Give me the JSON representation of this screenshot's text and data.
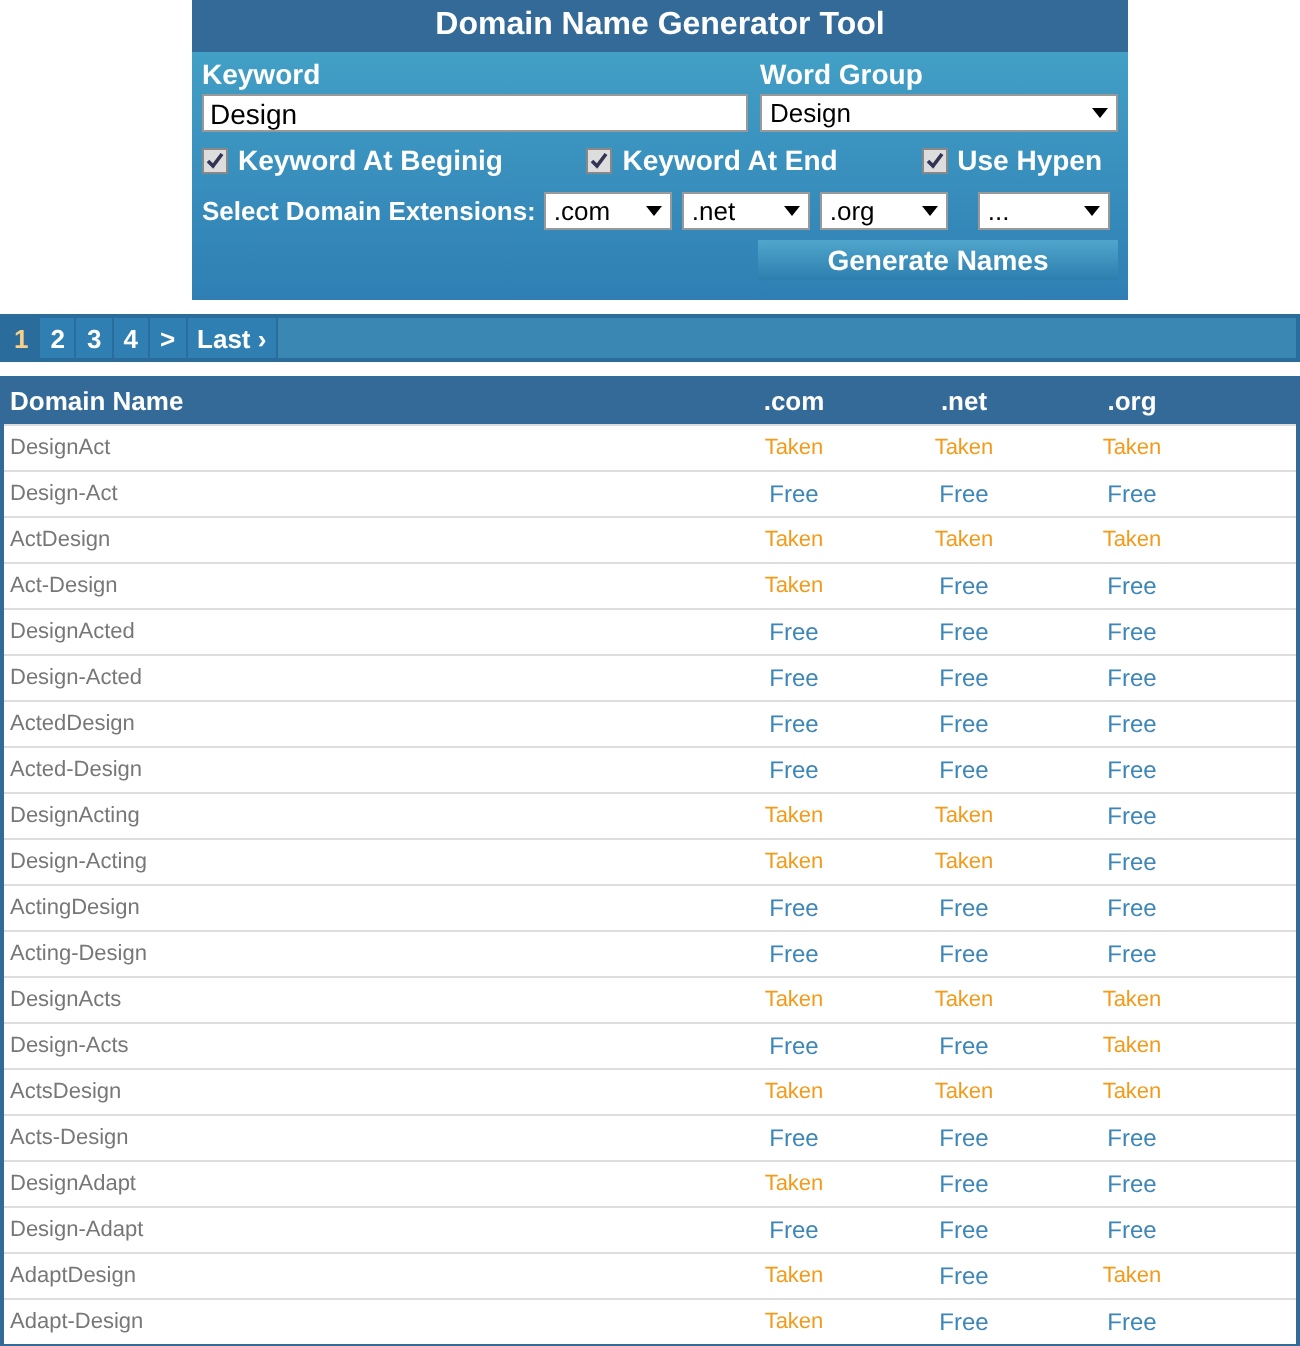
{
  "form": {
    "title": "Domain Name Generator Tool",
    "keyword_label": "Keyword",
    "keyword_value": "Design",
    "group_label": "Word Group",
    "group_value": "Design",
    "options": [
      {
        "label": "Keyword At Beginig",
        "checked": true
      },
      {
        "label": "Keyword At End",
        "checked": true
      },
      {
        "label": "Use Hypen",
        "checked": true
      }
    ],
    "extensions_label": "Select Domain Extensions:",
    "extensions": [
      ".com",
      ".net",
      ".org",
      "..."
    ],
    "button": "Generate Names"
  },
  "pagination": [
    {
      "label": "1",
      "selected": true
    },
    {
      "label": "2",
      "selected": false
    },
    {
      "label": "3",
      "selected": false
    },
    {
      "label": "4",
      "selected": false
    },
    {
      "label": ">",
      "selected": false
    },
    {
      "label": "Last ›",
      "selected": false
    }
  ],
  "table": {
    "columns": [
      "Domain Name",
      ".com",
      ".net",
      ".org"
    ],
    "rows": [
      {
        "cells": [
          {
            "kind": "name",
            "text": "DesignAct"
          },
          {
            "kind": "status",
            "text": "Taken",
            "taken": true
          },
          {
            "kind": "status",
            "text": "Taken",
            "taken": true
          },
          {
            "kind": "status",
            "text": "Taken",
            "taken": true
          }
        ]
      },
      {
        "cells": [
          {
            "kind": "name",
            "text": "Design-Act"
          },
          {
            "kind": "status",
            "text": "Free",
            "taken": false
          },
          {
            "kind": "status",
            "text": "Free",
            "taken": false
          },
          {
            "kind": "status",
            "text": "Free",
            "taken": false
          }
        ]
      },
      {
        "cells": [
          {
            "kind": "name",
            "text": "ActDesign"
          },
          {
            "kind": "status",
            "text": "Taken",
            "taken": true
          },
          {
            "kind": "status",
            "text": "Taken",
            "taken": true
          },
          {
            "kind": "status",
            "text": "Taken",
            "taken": true
          }
        ]
      },
      {
        "cells": [
          {
            "kind": "name",
            "text": "Act-Design"
          },
          {
            "kind": "status",
            "text": "Taken",
            "taken": true
          },
          {
            "kind": "status",
            "text": "Free",
            "taken": false
          },
          {
            "kind": "status",
            "text": "Free",
            "taken": false
          }
        ]
      },
      {
        "cells": [
          {
            "kind": "name",
            "text": "DesignActed"
          },
          {
            "kind": "status",
            "text": "Free",
            "taken": false
          },
          {
            "kind": "status",
            "text": "Free",
            "taken": false
          },
          {
            "kind": "status",
            "text": "Free",
            "taken": false
          }
        ]
      },
      {
        "cells": [
          {
            "kind": "name",
            "text": "Design-Acted"
          },
          {
            "kind": "status",
            "text": "Free",
            "taken": false
          },
          {
            "kind": "status",
            "text": "Free",
            "taken": false
          },
          {
            "kind": "status",
            "text": "Free",
            "taken": false
          }
        ]
      },
      {
        "cells": [
          {
            "kind": "name",
            "text": "ActedDesign"
          },
          {
            "kind": "status",
            "text": "Free",
            "taken": false
          },
          {
            "kind": "status",
            "text": "Free",
            "taken": false
          },
          {
            "kind": "status",
            "text": "Free",
            "taken": false
          }
        ]
      },
      {
        "cells": [
          {
            "kind": "name",
            "text": "Acted-Design"
          },
          {
            "kind": "status",
            "text": "Free",
            "taken": false
          },
          {
            "kind": "status",
            "text": "Free",
            "taken": false
          },
          {
            "kind": "status",
            "text": "Free",
            "taken": false
          }
        ]
      },
      {
        "cells": [
          {
            "kind": "name",
            "text": "DesignActing"
          },
          {
            "kind": "status",
            "text": "Taken",
            "taken": true
          },
          {
            "kind": "status",
            "text": "Taken",
            "taken": true
          },
          {
            "kind": "status",
            "text": "Free",
            "taken": false
          }
        ]
      },
      {
        "cells": [
          {
            "kind": "name",
            "text": "Design-Acting"
          },
          {
            "kind": "status",
            "text": "Taken",
            "taken": true
          },
          {
            "kind": "status",
            "text": "Taken",
            "taken": true
          },
          {
            "kind": "status",
            "text": "Free",
            "taken": false
          }
        ]
      },
      {
        "cells": [
          {
            "kind": "name",
            "text": "ActingDesign"
          },
          {
            "kind": "status",
            "text": "Free",
            "taken": false
          },
          {
            "kind": "status",
            "text": "Free",
            "taken": false
          },
          {
            "kind": "status",
            "text": "Free",
            "taken": false
          }
        ]
      },
      {
        "cells": [
          {
            "kind": "name",
            "text": "Acting-Design"
          },
          {
            "kind": "status",
            "text": "Free",
            "taken": false
          },
          {
            "kind": "status",
            "text": "Free",
            "taken": false
          },
          {
            "kind": "status",
            "text": "Free",
            "taken": false
          }
        ]
      },
      {
        "cells": [
          {
            "kind": "name",
            "text": "DesignActs"
          },
          {
            "kind": "status",
            "text": "Taken",
            "taken": true
          },
          {
            "kind": "status",
            "text": "Taken",
            "taken": true
          },
          {
            "kind": "status",
            "text": "Taken",
            "taken": true
          }
        ]
      },
      {
        "cells": [
          {
            "kind": "name",
            "text": "Design-Acts"
          },
          {
            "kind": "status",
            "text": "Free",
            "taken": false
          },
          {
            "kind": "status",
            "text": "Free",
            "taken": false
          },
          {
            "kind": "status",
            "text": "Taken",
            "taken": true
          }
        ]
      },
      {
        "cells": [
          {
            "kind": "name",
            "text": "ActsDesign"
          },
          {
            "kind": "status",
            "text": "Taken",
            "taken": true
          },
          {
            "kind": "status",
            "text": "Taken",
            "taken": true
          },
          {
            "kind": "status",
            "text": "Taken",
            "taken": true
          }
        ]
      },
      {
        "cells": [
          {
            "kind": "name",
            "text": "Acts-Design"
          },
          {
            "kind": "status",
            "text": "Free",
            "taken": false
          },
          {
            "kind": "status",
            "text": "Free",
            "taken": false
          },
          {
            "kind": "status",
            "text": "Free",
            "taken": false
          }
        ]
      },
      {
        "cells": [
          {
            "kind": "name",
            "text": "DesignAdapt"
          },
          {
            "kind": "status",
            "text": "Taken",
            "taken": true
          },
          {
            "kind": "status",
            "text": "Free",
            "taken": false
          },
          {
            "kind": "status",
            "text": "Free",
            "taken": false
          }
        ]
      },
      {
        "cells": [
          {
            "kind": "name",
            "text": "Design-Adapt"
          },
          {
            "kind": "status",
            "text": "Free",
            "taken": false
          },
          {
            "kind": "status",
            "text": "Free",
            "taken": false
          },
          {
            "kind": "status",
            "text": "Free",
            "taken": false
          }
        ]
      },
      {
        "cells": [
          {
            "kind": "name",
            "text": "AdaptDesign"
          },
          {
            "kind": "status",
            "text": "Taken",
            "taken": true
          },
          {
            "kind": "status",
            "text": "Free",
            "taken": false
          },
          {
            "kind": "status",
            "text": "Taken",
            "taken": true
          }
        ]
      },
      {
        "cells": [
          {
            "kind": "name",
            "text": "Adapt-Design"
          },
          {
            "kind": "status",
            "text": "Taken",
            "taken": true
          },
          {
            "kind": "status",
            "text": "Free",
            "taken": false
          },
          {
            "kind": "status",
            "text": "Free",
            "taken": false
          }
        ]
      }
    ]
  }
}
